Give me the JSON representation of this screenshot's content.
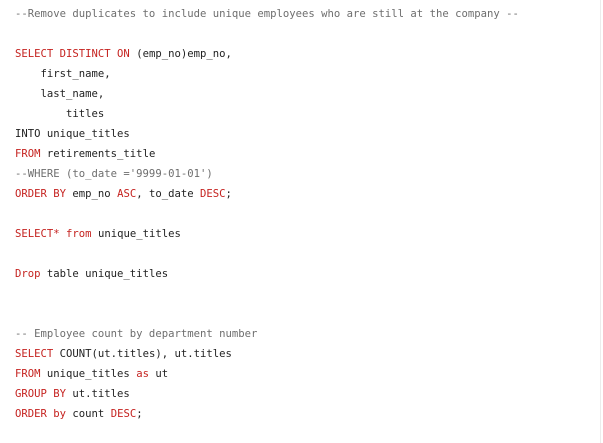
{
  "colors": {
    "background": "#ffffff",
    "keyword": "#c5221f",
    "comment": "#6e6e6e",
    "text": "#1f1f1f"
  },
  "code": {
    "lines": [
      [
        {
          "t": "--Remove duplicates to include unique employees who are still at the company --",
          "k": "cm"
        }
      ],
      [],
      [
        {
          "t": "SELECT DISTINCT ON",
          "k": "kw"
        },
        {
          "t": " (emp_no)emp_no,",
          "k": "id"
        }
      ],
      [
        {
          "t": "    first_name,",
          "k": "id"
        }
      ],
      [
        {
          "t": "    last_name,",
          "k": "id"
        }
      ],
      [
        {
          "t": "        titles",
          "k": "id"
        }
      ],
      [
        {
          "t": "INTO",
          "k": "id"
        },
        {
          "t": " unique_titles",
          "k": "id"
        }
      ],
      [
        {
          "t": "FROM",
          "k": "kw"
        },
        {
          "t": " retirements_title",
          "k": "id"
        }
      ],
      [
        {
          "t": "--WHERE (to_date ='9999-01-01')",
          "k": "cm"
        }
      ],
      [
        {
          "t": "ORDER BY",
          "k": "kw"
        },
        {
          "t": " emp_no ",
          "k": "id"
        },
        {
          "t": "ASC",
          "k": "kw"
        },
        {
          "t": ", to_date ",
          "k": "id"
        },
        {
          "t": "DESC",
          "k": "kw"
        },
        {
          "t": ";",
          "k": "id"
        }
      ],
      [],
      [
        {
          "t": "SELECT*",
          "k": "kw"
        },
        {
          "t": " ",
          "k": "id"
        },
        {
          "t": "from",
          "k": "kw"
        },
        {
          "t": " unique_titles",
          "k": "id"
        }
      ],
      [],
      [
        {
          "t": "Drop",
          "k": "kw"
        },
        {
          "t": " table unique_titles",
          "k": "id"
        }
      ],
      [],
      [],
      [
        {
          "t": "-- Employee count by department number",
          "k": "cm"
        }
      ],
      [
        {
          "t": "SELECT",
          "k": "kw"
        },
        {
          "t": " COUNT(ut.titles), ut.titles",
          "k": "id"
        }
      ],
      [
        {
          "t": "FROM",
          "k": "kw"
        },
        {
          "t": " unique_titles ",
          "k": "id"
        },
        {
          "t": "as",
          "k": "kw"
        },
        {
          "t": " ut",
          "k": "id"
        }
      ],
      [
        {
          "t": "GROUP BY",
          "k": "kw"
        },
        {
          "t": " ut.titles",
          "k": "id"
        }
      ],
      [
        {
          "t": "ORDER by",
          "k": "kw"
        },
        {
          "t": " count ",
          "k": "id"
        },
        {
          "t": "DESC",
          "k": "kw"
        },
        {
          "t": ";",
          "k": "id"
        }
      ]
    ]
  }
}
